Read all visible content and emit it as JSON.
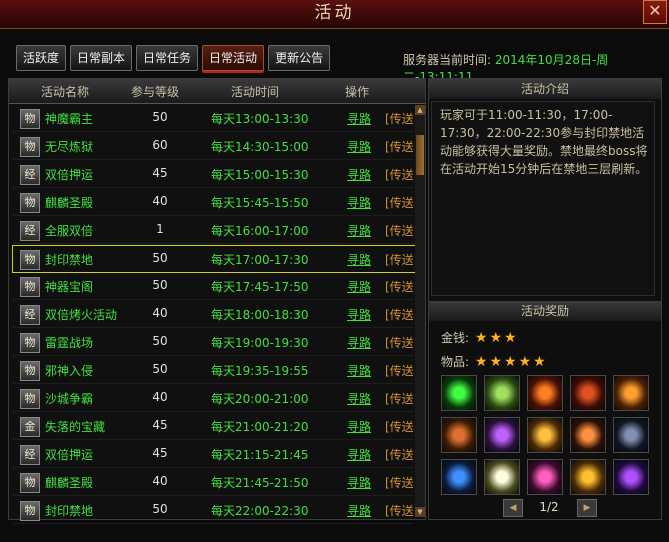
{
  "window": {
    "title": "活动",
    "close_label": "✕"
  },
  "tabs": [
    "活跃度",
    "日常副本",
    "日常任务",
    "日常活动",
    "更新公告"
  ],
  "active_tab": 3,
  "server_time": {
    "label": "服务器当前时间:",
    "value": "2014年10月28日-周二-13:11:11"
  },
  "table": {
    "headers": {
      "name": "活动名称",
      "level": "参与等级",
      "time": "活动时间",
      "ops": "操作"
    },
    "rows": [
      {
        "icon": "物",
        "name": "神魔霸主",
        "level": "50",
        "time": "每天13:00-13:30",
        "seek": "寻路",
        "tele": "[传送]"
      },
      {
        "icon": "物",
        "name": "无尽炼狱",
        "level": "60",
        "time": "每天14:30-15:00",
        "seek": "寻路",
        "tele": "[传送]"
      },
      {
        "icon": "经",
        "name": "双倍押运",
        "level": "45",
        "time": "每天15:00-15:30",
        "seek": "寻路",
        "tele": "[传送]"
      },
      {
        "icon": "物",
        "name": "麒麟圣殿",
        "level": "40",
        "time": "每天15:45-15:50",
        "seek": "寻路",
        "tele": "[传送]"
      },
      {
        "icon": "经",
        "name": "全服双倍",
        "level": "1",
        "time": "每天16:00-17:00",
        "seek": "寻路",
        "tele": "[传送]"
      },
      {
        "icon": "物",
        "name": "封印禁地",
        "level": "50",
        "time": "每天17:00-17:30",
        "seek": "寻路",
        "tele": "[传送]"
      },
      {
        "icon": "物",
        "name": "神器宝阁",
        "level": "50",
        "time": "每天17:45-17:50",
        "seek": "寻路",
        "tele": "[传送]"
      },
      {
        "icon": "经",
        "name": "双倍烤火活动",
        "level": "40",
        "time": "每天18:00-18:30",
        "seek": "寻路",
        "tele": "[传送]"
      },
      {
        "icon": "物",
        "name": "雷霆战场",
        "level": "50",
        "time": "每天19:00-19:30",
        "seek": "寻路",
        "tele": "[传送]"
      },
      {
        "icon": "物",
        "name": "邪神入侵",
        "level": "50",
        "time": "每天19:35-19:55",
        "seek": "寻路",
        "tele": "[传送]"
      },
      {
        "icon": "物",
        "name": "沙城争霸",
        "level": "40",
        "time": "每天20:00-21:00",
        "seek": "寻路",
        "tele": "[传送]"
      },
      {
        "icon": "金",
        "name": "失落的宝藏",
        "level": "45",
        "time": "每天21:00-21:20",
        "seek": "寻路",
        "tele": "[传送]"
      },
      {
        "icon": "经",
        "name": "双倍押运",
        "level": "45",
        "time": "每天21:15-21:45",
        "seek": "寻路",
        "tele": "[传送]"
      },
      {
        "icon": "物",
        "name": "麒麟圣殿",
        "level": "40",
        "time": "每天21:45-21:50",
        "seek": "寻路",
        "tele": "[传送]"
      },
      {
        "icon": "物",
        "name": "封印禁地",
        "level": "50",
        "time": "每天22:00-22:30",
        "seek": "寻路",
        "tele": "[传送]"
      }
    ],
    "selected_index": 5
  },
  "intro": {
    "heading": "活动介绍",
    "text": "玩家可于11:00-11:30，17:00-17:30，22:00-22:30参与封印禁地活动能够获得大量奖励。禁地最终boss将在活动开始15分钟后在禁地三层刷新。"
  },
  "rewards": {
    "heading": "活动奖励",
    "gold_label": "金钱:",
    "gold_stars": 3,
    "items_label": "物品:",
    "items_stars": 5,
    "item_icons": [
      "green-orb-icon",
      "green-ring-icon",
      "fire-armor-icon",
      "demon-armor-icon",
      "fire-armor-icon-2",
      "wing-boots-icon",
      "purple-bracelet-icon",
      "crown-icon",
      "sword-icon",
      "dark-armor-icon",
      "blue-armor-icon",
      "white-pearl-icon",
      "pink-flower-icon",
      "golden-feather-icon",
      "purple-gem-icon"
    ],
    "page": "1/2"
  },
  "colors": {
    "green_text": "#40e040",
    "star": "#ffb020",
    "select_border": "#d0d020",
    "title_bg": "#5a1010"
  }
}
